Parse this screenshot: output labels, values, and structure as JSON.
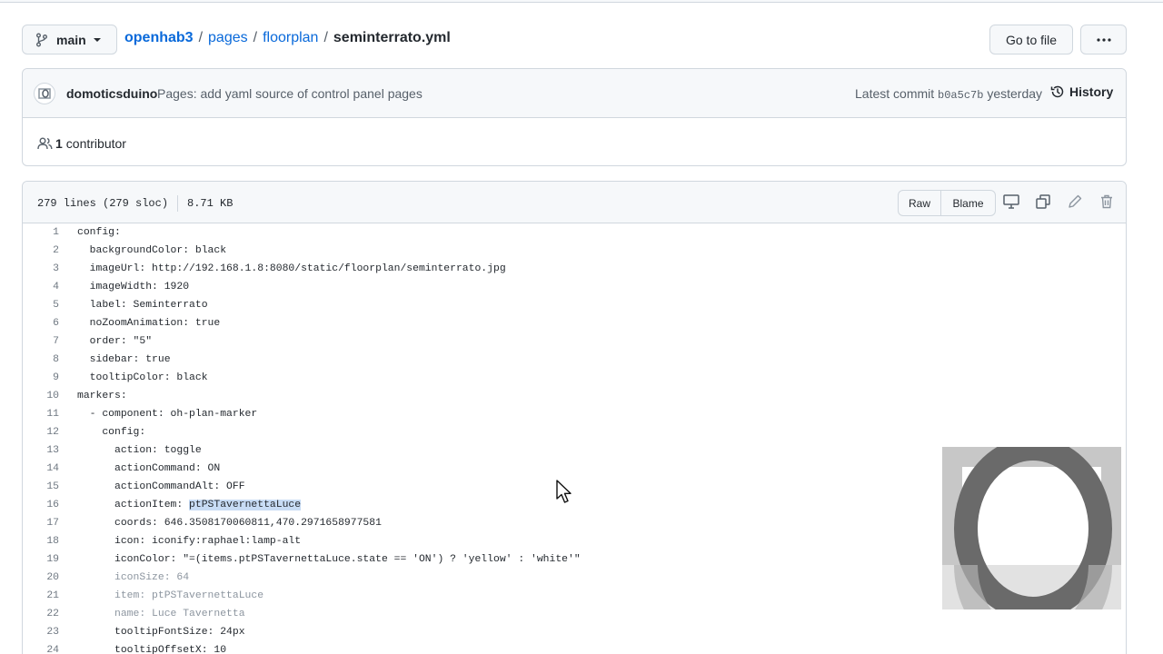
{
  "branch": {
    "label": "main"
  },
  "breadcrumb": {
    "repo": "openhab3",
    "sep": "/",
    "dir1": "pages",
    "dir2": "floorplan",
    "file": "seminterrato.yml"
  },
  "actions": {
    "goto_file": "Go to file",
    "more": "···"
  },
  "commit": {
    "author": "domoticsduino",
    "message": "Pages: add yaml source of control panel pages",
    "latest_label": "Latest commit",
    "sha": "b0a5c7b",
    "time": "yesterday",
    "history_label": "History"
  },
  "contributors": {
    "count": "1",
    "label": "contributor"
  },
  "file": {
    "lines_info": "279 lines (279 sloc)",
    "size": "8.71 KB",
    "raw_label": "Raw",
    "blame_label": "Blame"
  },
  "code_lines": [
    {
      "n": "1",
      "text": "config:"
    },
    {
      "n": "2",
      "text": "  backgroundColor: black"
    },
    {
      "n": "3",
      "text": "  imageUrl: http://192.168.1.8:8080/static/floorplan/seminterrato.jpg"
    },
    {
      "n": "4",
      "text": "  imageWidth: 1920"
    },
    {
      "n": "5",
      "text": "  label: Seminterrato"
    },
    {
      "n": "6",
      "text": "  noZoomAnimation: true"
    },
    {
      "n": "7",
      "text": "  order: \"5\""
    },
    {
      "n": "8",
      "text": "  sidebar: true"
    },
    {
      "n": "9",
      "text": "  tooltipColor: black"
    },
    {
      "n": "10",
      "text": "markers:"
    },
    {
      "n": "11",
      "text": "  - component: oh-plan-marker"
    },
    {
      "n": "12",
      "text": "    config:"
    },
    {
      "n": "13",
      "text": "      action: toggle"
    },
    {
      "n": "14",
      "text": "      actionCommand: ON"
    },
    {
      "n": "15",
      "text": "      actionCommandAlt: OFF"
    },
    {
      "n": "16",
      "text": "      actionItem: ",
      "highlight": "ptPSTavernettaLuce"
    },
    {
      "n": "17",
      "text": "      coords: 646.3508170060811,470.2971658977581"
    },
    {
      "n": "18",
      "text": "      icon: iconify:raphael:lamp-alt"
    },
    {
      "n": "19",
      "text": "      iconColor: \"=(items.ptPSTavernettaLuce.state == 'ON') ? 'yellow' : 'white'\""
    },
    {
      "n": "20",
      "text": "      iconSize: 64",
      "faded": true
    },
    {
      "n": "21",
      "text": "      item: ptPSTavernettaLuce",
      "faded": true
    },
    {
      "n": "22",
      "text": "      name: Luce Tavernetta",
      "faded": true
    },
    {
      "n": "23",
      "text": "      tooltipFontSize: 24px"
    },
    {
      "n": "24",
      "text": "      tooltipOffsetX: 10"
    }
  ],
  "colors": {
    "link": "#0969da",
    "border": "#d0d7de",
    "header_bg": "#f6f8fa",
    "highlight": "#c8dcf5"
  },
  "icons": [
    "branch-icon",
    "caret-down-icon",
    "kebab-icon",
    "history-icon",
    "people-icon",
    "desktop-icon",
    "copy-icon",
    "pencil-icon",
    "trash-icon"
  ]
}
